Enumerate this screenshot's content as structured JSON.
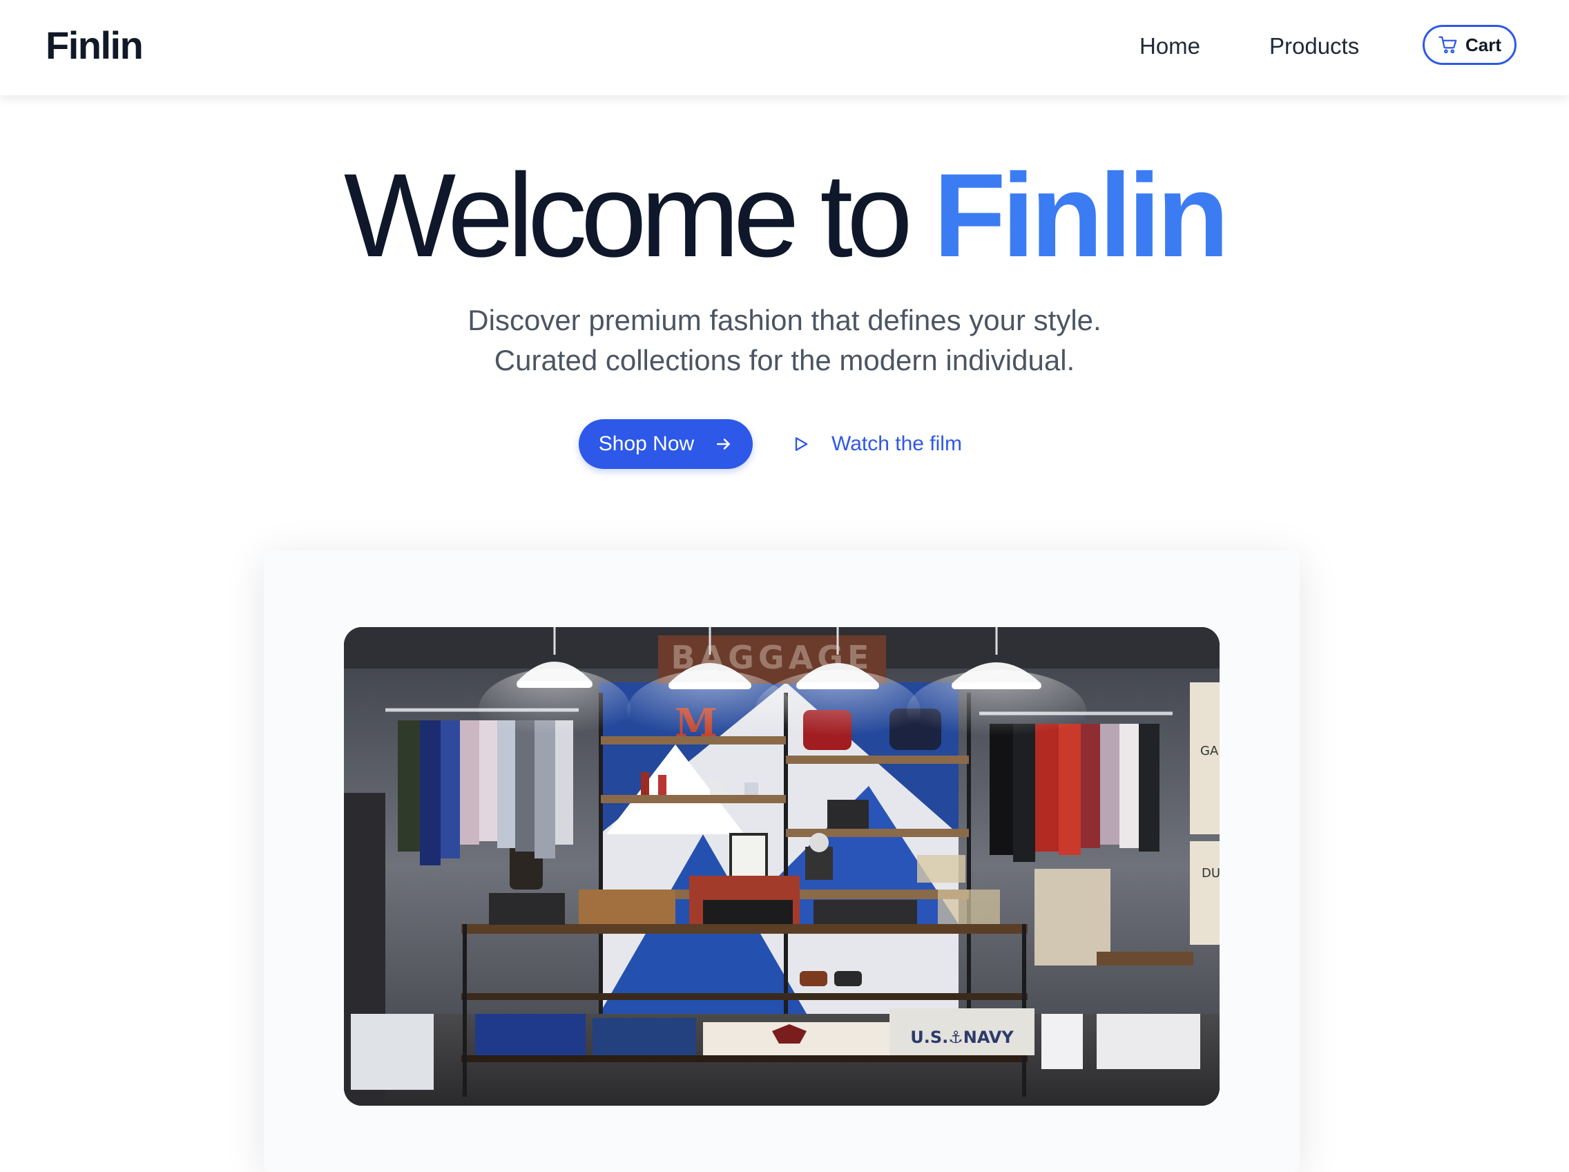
{
  "header": {
    "logo": "Finlin",
    "nav": {
      "home": "Home",
      "products": "Products"
    },
    "cart_label": "Cart",
    "cart_icon": "shopping-cart-icon"
  },
  "hero": {
    "title_prefix": "Welcome to",
    "title_accent": "Finlin",
    "subtitle_line1": "Discover premium fashion that defines your style.",
    "subtitle_line2": "Curated collections for the modern individual.",
    "primary_cta": "Shop Now",
    "primary_cta_icon": "arrow-right-icon",
    "secondary_cta": "Watch the film",
    "secondary_cta_icon": "play-icon"
  },
  "showcase": {
    "image_description_alt": "Clothing store interior with shelves and racks",
    "wall_signs": [
      "GA",
      "DU"
    ],
    "shirt_print": "U.S.⚓NAVY",
    "letter_sign": "M"
  },
  "colors": {
    "brand_blue": "#2d58e8",
    "accent_blue": "#3b7cf2",
    "text_dark": "#111827",
    "text_muted": "#4b5563"
  }
}
